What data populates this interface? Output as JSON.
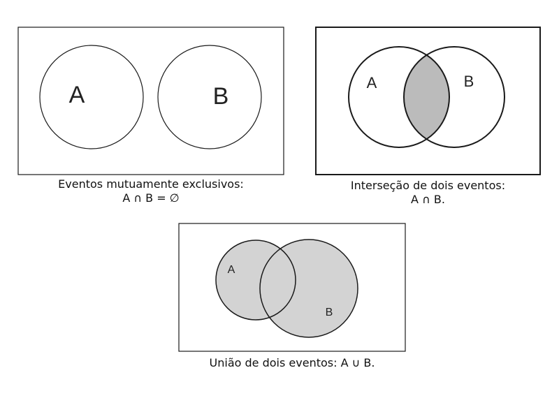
{
  "diagrams": [
    {
      "caption_line1": "Eventos mutuamente exclusivos:",
      "caption_line2": "A ∩ B = ∅",
      "label_a": "A",
      "label_b": "B",
      "shaded": "none"
    },
    {
      "caption_line1": "Interseção de dois eventos:",
      "caption_line2": "A ∩ B.",
      "label_a": "A",
      "label_b": "B",
      "shaded": "intersection"
    },
    {
      "caption_line1": "União de dois eventos: A ∪ B.",
      "label_a": "A",
      "label_b": "B",
      "shaded": "union"
    }
  ],
  "colors": {
    "stroke": "#1a1a1a",
    "intersection_fill": "#bbbbbb",
    "union_fill": "#d3d3d3",
    "background": "#ffffff"
  }
}
